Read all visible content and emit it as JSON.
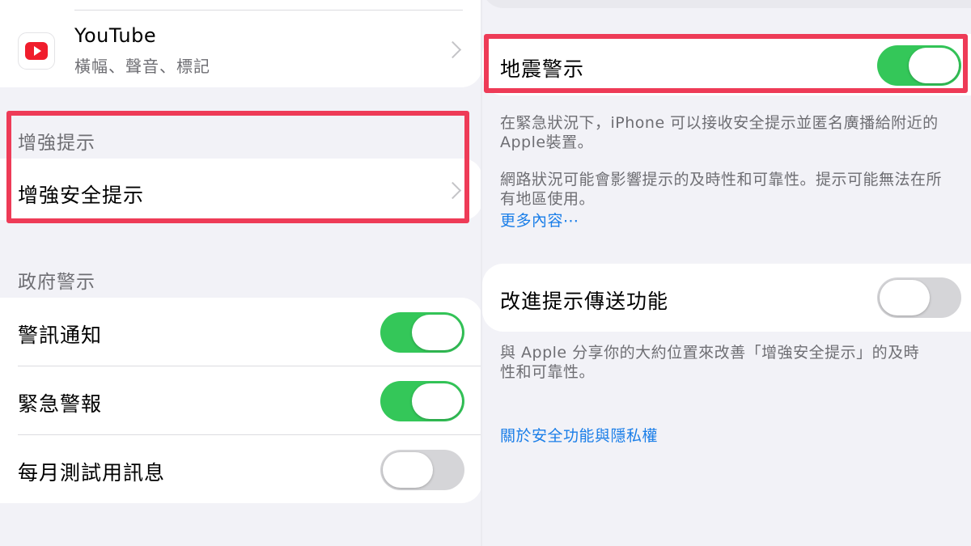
{
  "left": {
    "youtube": {
      "title": "YouTube",
      "subtitle": "橫幅、聲音、標記",
      "icon": "youtube-icon"
    },
    "enhanced_section": {
      "header": "增強提示",
      "item": "增強安全提示"
    },
    "government_section": {
      "header": "政府警示",
      "items": [
        {
          "label": "警訊通知",
          "on": true
        },
        {
          "label": "緊急警報",
          "on": true
        },
        {
          "label": "每月測試用訊息",
          "on": false
        }
      ]
    }
  },
  "right": {
    "earthquake": {
      "label": "地震警示",
      "on": true
    },
    "earthquake_footer": {
      "line1": "在緊急狀況下，iPhone 可以接收安全提示並匿名廣播給附近的",
      "line2": "Apple裝置。",
      "line3": "網路狀況可能會影響提示的及時性和可靠性。提示可能無法在所",
      "line4": "有地區使用。",
      "more": "更多內容⋯"
    },
    "improve": {
      "label": "改進提示傳送功能",
      "on": false
    },
    "improve_footer": {
      "line1": "與 Apple 分享你的大約位置來改善「增強安全提示」的及時",
      "line2": "性和可靠性。"
    },
    "privacy_link": "關於安全功能與隱私權"
  },
  "colors": {
    "toggle_on": "#34c759",
    "toggle_off": "#d5d5d8",
    "highlight": "#ee3b57",
    "link": "#1a7ee8"
  }
}
